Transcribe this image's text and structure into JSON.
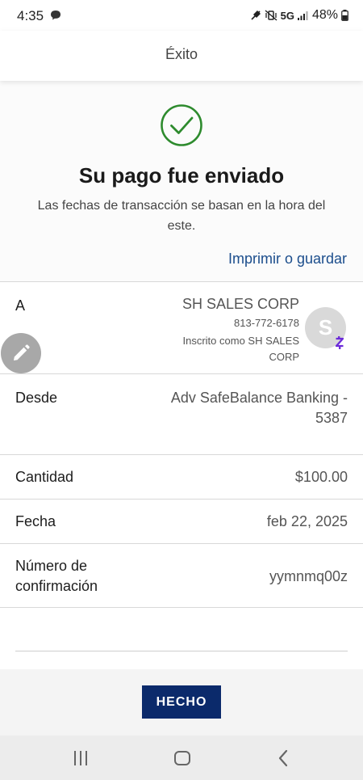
{
  "status_bar": {
    "time": "4:35",
    "network": "5G",
    "battery": "48%"
  },
  "header": {
    "title": "Éxito"
  },
  "success": {
    "title": "Su pago fue enviado",
    "subtitle": "Las fechas de transacción se basan en la hora del este.",
    "print_link": "Imprimir o guardar",
    "check_color": "#2e8b2e"
  },
  "recipient": {
    "label": "A",
    "name": "SH SALES CORP",
    "phone": "813-772-6178",
    "enrolled": "Inscrito como SH SALES CORP",
    "avatar_initial": "S",
    "badge_icon": "zelle-icon"
  },
  "from": {
    "label": "Desde",
    "value": "Adv SafeBalance Banking - 5387"
  },
  "amount": {
    "label": "Cantidad",
    "value": "$100.00"
  },
  "date": {
    "label": "Fecha",
    "value": "feb 22, 2025"
  },
  "confirmation": {
    "label": "Número de confirmación",
    "value": "yymnmq00z"
  },
  "footer": {
    "done_label": "HECHO",
    "accent": "#0b2a6b"
  },
  "nav": {
    "icons": [
      "recent-apps-icon",
      "home-icon",
      "back-icon"
    ]
  }
}
